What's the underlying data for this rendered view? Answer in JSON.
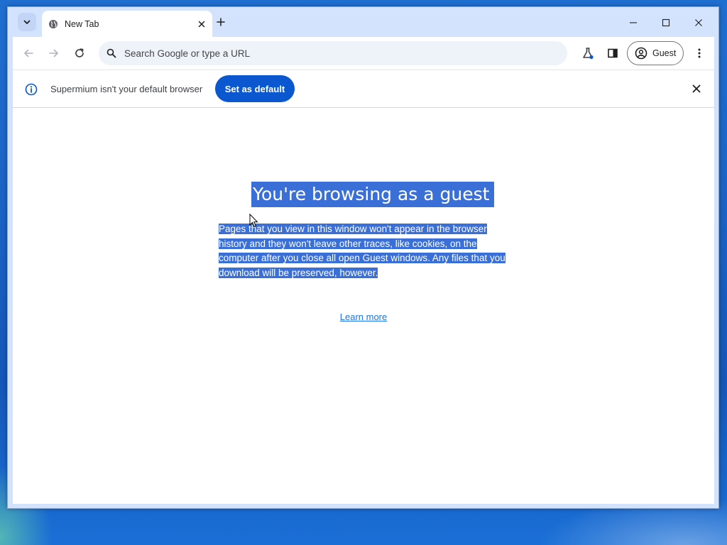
{
  "tabstrip": {
    "tab_title": "New Tab",
    "tab_search_icon": "chevron-down-icon",
    "new_tab_icon": "plus-icon"
  },
  "toolbar": {
    "omnibox_placeholder": "Search Google or type a URL",
    "profile_label": "Guest"
  },
  "infobar": {
    "message": "Supermium isn't your default browser",
    "button_label": "Set as default"
  },
  "content": {
    "title": "You're browsing as a guest",
    "description": "Pages that you view in this window won't appear in the browser history and they won't leave other traces, like cookies, on the computer after you close all open Guest windows. Any files that you download will be preserved, however.",
    "learn_more": "Learn more"
  },
  "colors": {
    "accent": "#0b57d0",
    "selection": "#3a6fd8",
    "tabstrip_bg": "#d3e3fd",
    "link": "#1a73e8"
  }
}
